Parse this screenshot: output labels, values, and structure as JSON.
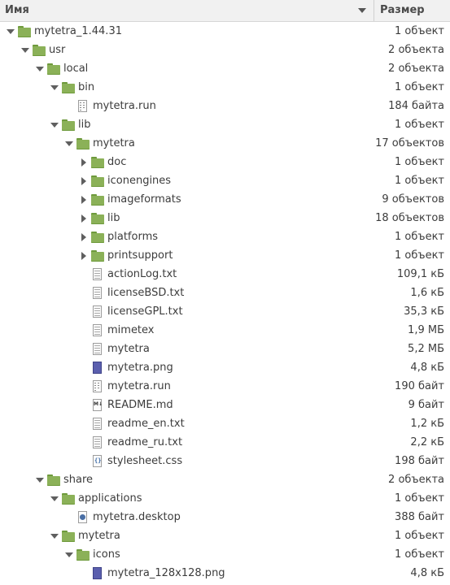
{
  "header": {
    "name_label": "Имя",
    "size_label": "Размер"
  },
  "rows": [
    {
      "name": "mytetra_1.44.31",
      "size": "1 объект",
      "depth": 0,
      "type": "folder",
      "exp": "open"
    },
    {
      "name": "usr",
      "size": "2 объекта",
      "depth": 1,
      "type": "folder",
      "exp": "open"
    },
    {
      "name": "local",
      "size": "2 объекта",
      "depth": 2,
      "type": "folder",
      "exp": "open"
    },
    {
      "name": "bin",
      "size": "1 объект",
      "depth": 3,
      "type": "folder",
      "exp": "open"
    },
    {
      "name": "mytetra.run",
      "size": "184 байта",
      "depth": 4,
      "type": "script",
      "exp": "none"
    },
    {
      "name": "lib",
      "size": "1 объект",
      "depth": 3,
      "type": "folder",
      "exp": "open"
    },
    {
      "name": "mytetra",
      "size": "17 объектов",
      "depth": 4,
      "type": "folder",
      "exp": "open"
    },
    {
      "name": "doc",
      "size": "1 объект",
      "depth": 5,
      "type": "folder",
      "exp": "closed"
    },
    {
      "name": "iconengines",
      "size": "1 объект",
      "depth": 5,
      "type": "folder",
      "exp": "closed"
    },
    {
      "name": "imageformats",
      "size": "9 объектов",
      "depth": 5,
      "type": "folder",
      "exp": "closed"
    },
    {
      "name": "lib",
      "size": "18 объектов",
      "depth": 5,
      "type": "folder",
      "exp": "closed"
    },
    {
      "name": "platforms",
      "size": "1 объект",
      "depth": 5,
      "type": "folder",
      "exp": "closed"
    },
    {
      "name": "printsupport",
      "size": "1 объект",
      "depth": 5,
      "type": "folder",
      "exp": "closed"
    },
    {
      "name": "actionLog.txt",
      "size": "109,1 кБ",
      "depth": 5,
      "type": "file",
      "exp": "none"
    },
    {
      "name": "licenseBSD.txt",
      "size": "1,6 кБ",
      "depth": 5,
      "type": "file",
      "exp": "none"
    },
    {
      "name": "licenseGPL.txt",
      "size": "35,3 кБ",
      "depth": 5,
      "type": "file",
      "exp": "none"
    },
    {
      "name": "mimetex",
      "size": "1,9 МБ",
      "depth": 5,
      "type": "file",
      "exp": "none"
    },
    {
      "name": "mytetra",
      "size": "5,2 МБ",
      "depth": 5,
      "type": "file",
      "exp": "none"
    },
    {
      "name": "mytetra.png",
      "size": "4,8 кБ",
      "depth": 5,
      "type": "image",
      "exp": "none"
    },
    {
      "name": "mytetra.run",
      "size": "190 байт",
      "depth": 5,
      "type": "script",
      "exp": "none"
    },
    {
      "name": "README.md",
      "size": "9 байт",
      "depth": 5,
      "type": "md",
      "exp": "none"
    },
    {
      "name": "readme_en.txt",
      "size": "1,2 кБ",
      "depth": 5,
      "type": "file",
      "exp": "none"
    },
    {
      "name": "readme_ru.txt",
      "size": "2,2 кБ",
      "depth": 5,
      "type": "file",
      "exp": "none"
    },
    {
      "name": "stylesheet.css",
      "size": "198 байт",
      "depth": 5,
      "type": "css",
      "exp": "none"
    },
    {
      "name": "share",
      "size": "2 объекта",
      "depth": 2,
      "type": "folder",
      "exp": "open"
    },
    {
      "name": "applications",
      "size": "1 объект",
      "depth": 3,
      "type": "folder",
      "exp": "open"
    },
    {
      "name": "mytetra.desktop",
      "size": "388 байт",
      "depth": 4,
      "type": "desktop",
      "exp": "none"
    },
    {
      "name": "mytetra",
      "size": "1 объект",
      "depth": 3,
      "type": "folder",
      "exp": "open"
    },
    {
      "name": "icons",
      "size": "1 объект",
      "depth": 4,
      "type": "folder",
      "exp": "open"
    },
    {
      "name": "mytetra_128x128.png",
      "size": "4,8 кБ",
      "depth": 5,
      "type": "image",
      "exp": "none"
    }
  ]
}
